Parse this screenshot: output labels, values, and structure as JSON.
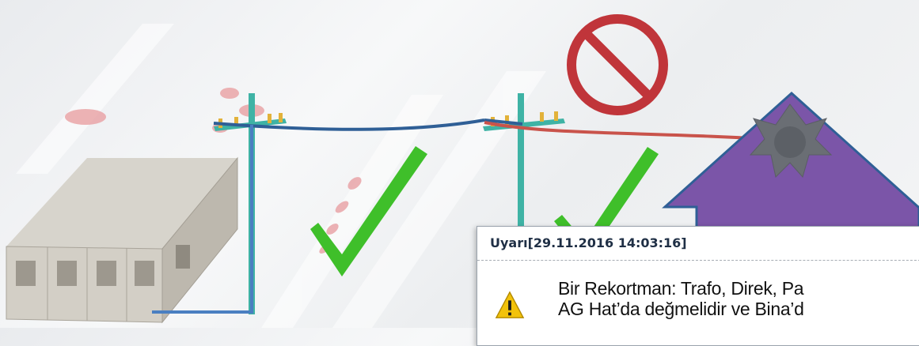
{
  "dialog": {
    "title": "Uyarı[29.11.2016 14:03:16]",
    "message_line1": "Bir Rekortman: Trafo, Direk, Pa",
    "message_line2": "AG Hat’da değmelidir ve Bina’d",
    "icon": "warning-icon"
  },
  "colors": {
    "line_blue": "#2f5f96",
    "line_red": "#c9534b",
    "house_purple": "#7b55a8",
    "check_green": "#3fbf2a",
    "no_sign_red": "#c0353a",
    "pole_teal": "#3fb3a5"
  }
}
